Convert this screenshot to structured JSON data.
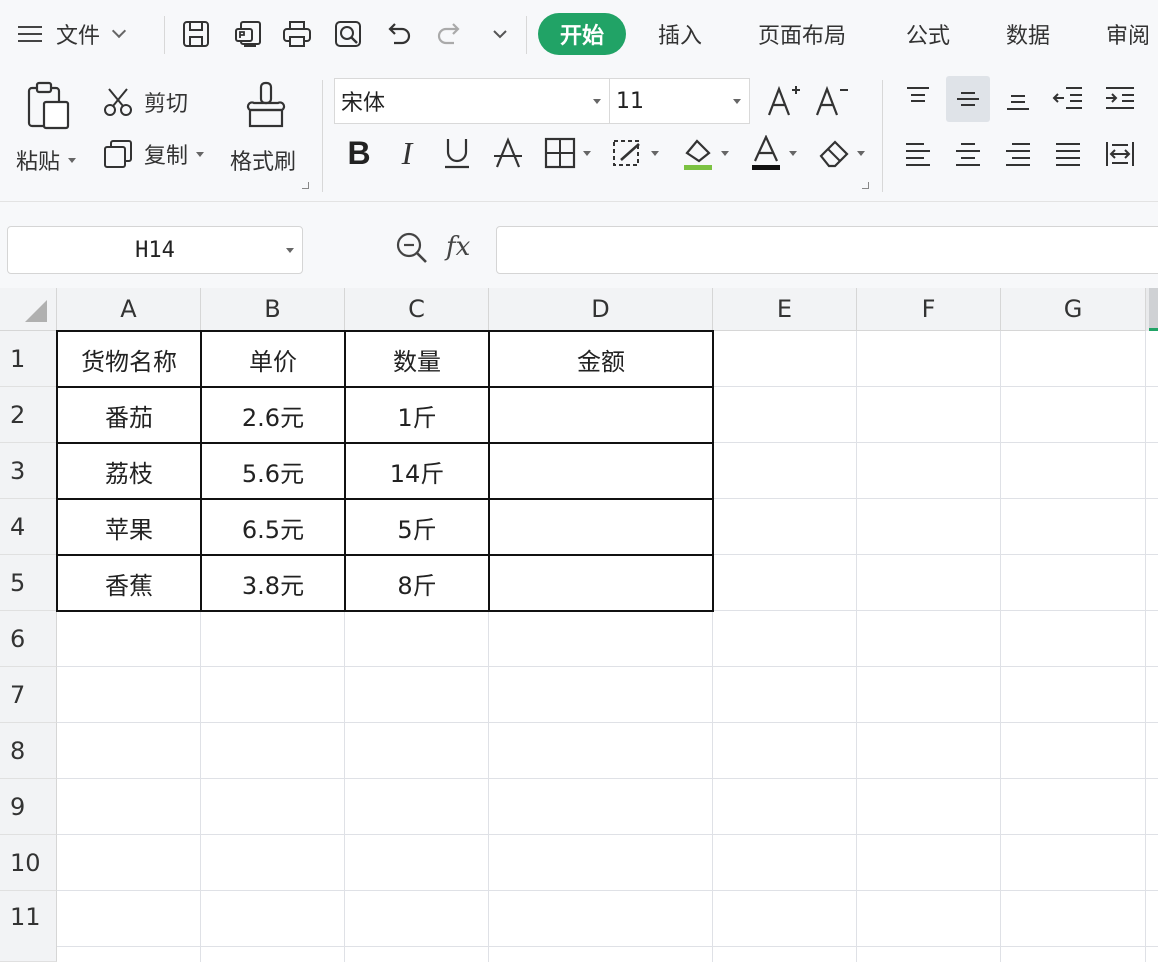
{
  "menubar": {
    "file_label": "文件",
    "tabs": [
      "开始",
      "插入",
      "页面布局",
      "公式",
      "数据",
      "审阅"
    ],
    "active_tab": "开始",
    "accent_color": "#21a366",
    "quick_access_icons": [
      "save-icon",
      "export-pdf-icon",
      "print-icon",
      "print-preview-icon",
      "undo-icon",
      "redo-icon",
      "customize-dropdown-icon"
    ]
  },
  "ribbon": {
    "paste_label": "粘贴",
    "cut_label": "剪切",
    "copy_label": "复制",
    "format_painter_label": "格式刷",
    "font_name": "宋体",
    "font_size": "11",
    "font_color_underline": "#e5433a",
    "fill_color_underline": "#7cc242",
    "font_buttons": [
      "bold-icon",
      "italic-icon",
      "underline-icon",
      "strikethrough-icon",
      "borders-icon",
      "cell-style-icon",
      "fill-color-icon",
      "font-color-icon",
      "clear-format-icon"
    ],
    "align_buttons": [
      "align-top-icon",
      "align-middle-icon",
      "align-bottom-icon",
      "decrease-indent-icon",
      "increase-indent-icon",
      "align-left-icon",
      "align-center-icon",
      "align-right-icon",
      "justify-icon",
      "distributed-icon"
    ],
    "active_alignment": "align-middle-icon"
  },
  "formula_bar": {
    "cell_reference": "H14",
    "fx_label": "fx",
    "formula_value": ""
  },
  "sheet": {
    "column_headers": [
      "A",
      "B",
      "C",
      "D",
      "E",
      "F",
      "G"
    ],
    "row_headers": [
      "1",
      "2",
      "3",
      "4",
      "5",
      "6",
      "7",
      "8",
      "9",
      "10",
      "11"
    ],
    "header_row": [
      "货物名称",
      "单价",
      "数量",
      "金额"
    ],
    "rows": [
      [
        "番茄",
        "2.6元",
        "1斤",
        ""
      ],
      [
        "荔枝",
        "5.6元",
        "14斤",
        ""
      ],
      [
        "苹果",
        "6.5元",
        "5斤",
        ""
      ],
      [
        "香蕉",
        "3.8元",
        "8斤",
        ""
      ]
    ]
  }
}
